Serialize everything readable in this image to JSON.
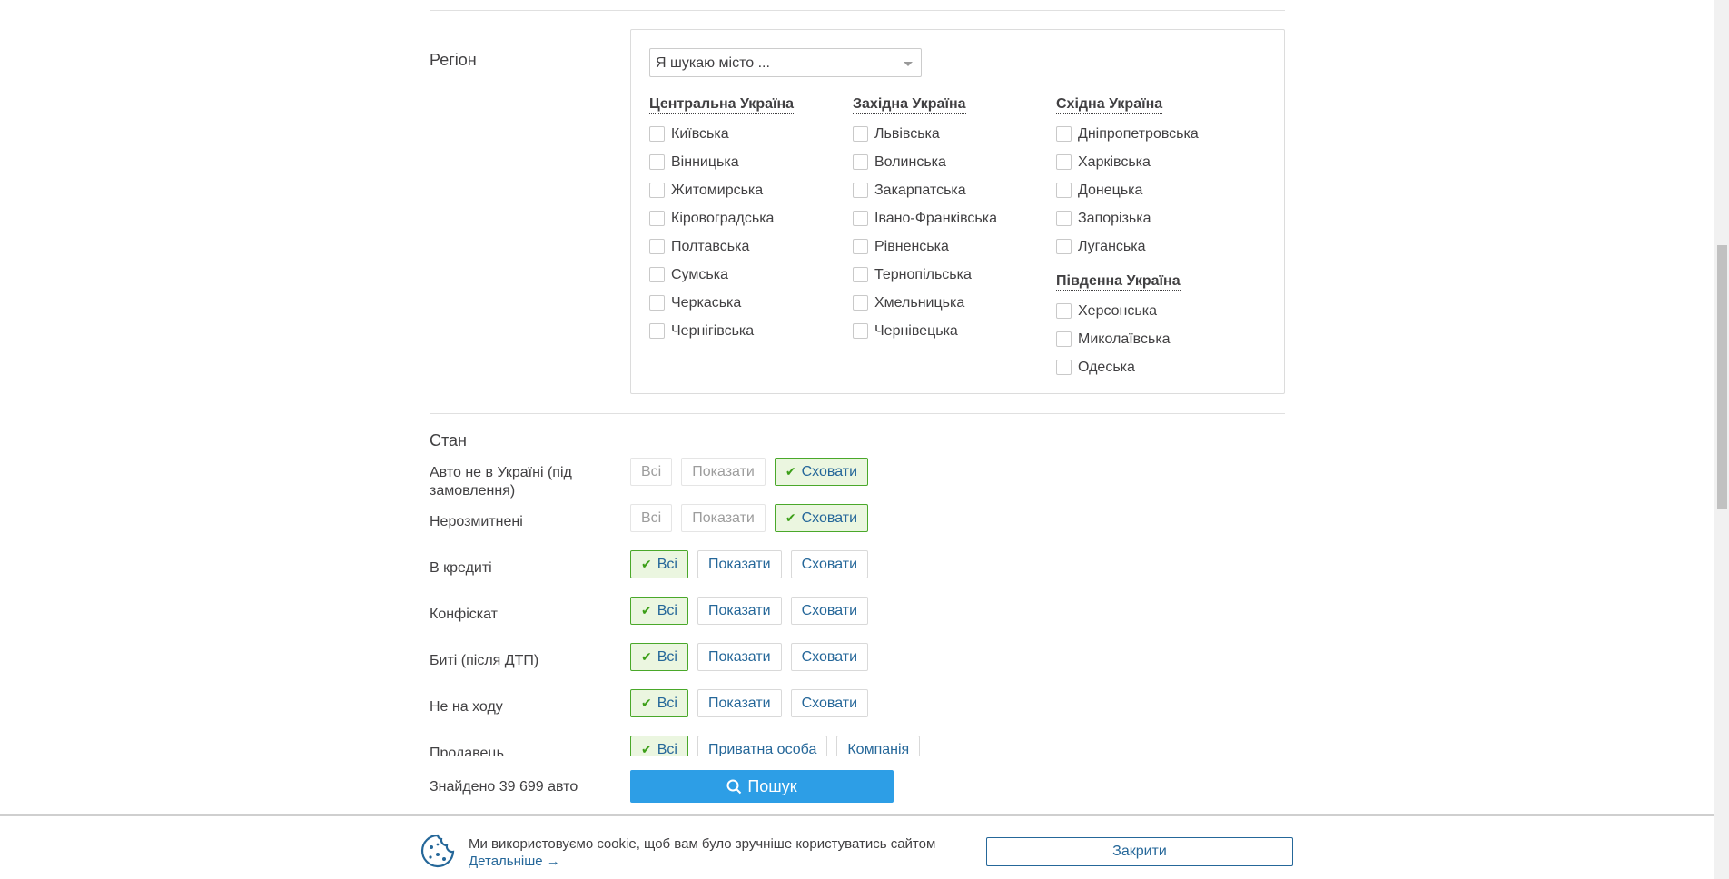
{
  "region": {
    "label": "Регіон",
    "city_placeholder": "Я шукаю місто ...",
    "groups": [
      {
        "title": "Центральна Україна",
        "items": [
          "Київська",
          "Вінницька",
          "Житомирська",
          "Кіровоградська",
          "Полтавська",
          "Сумська",
          "Черкаська",
          "Чернігівська"
        ]
      },
      {
        "title": "Західна Україна",
        "items": [
          "Львівська",
          "Волинська",
          "Закарпатська",
          "Івано-Франківська",
          "Рівненська",
          "Тернопільська",
          "Хмельницька",
          "Чернівецька"
        ]
      },
      {
        "title": "Східна Україна",
        "items": [
          "Дніпропетровська",
          "Харківська",
          "Донецька",
          "Запорізька",
          "Луганська"
        ]
      },
      {
        "title": "Південна Україна",
        "items": [
          "Херсонська",
          "Миколаївська",
          "Одеська"
        ]
      }
    ]
  },
  "state": {
    "title": "Стан",
    "rows": [
      {
        "label": "Авто не в Україні (під замовлення)",
        "buttons": [
          "Всі",
          "Показати",
          "Сховати"
        ],
        "selected": 2,
        "dim": true
      },
      {
        "label": "Нерозмитнені",
        "buttons": [
          "Всі",
          "Показати",
          "Сховати"
        ],
        "selected": 2,
        "dim": true
      },
      {
        "label": "В кредиті",
        "buttons": [
          "Всі",
          "Показати",
          "Сховати"
        ],
        "selected": 0,
        "dim": false
      },
      {
        "label": "Конфіскат",
        "buttons": [
          "Всі",
          "Показати",
          "Сховати"
        ],
        "selected": 0,
        "dim": false
      },
      {
        "label": "Биті (після ДТП)",
        "buttons": [
          "Всі",
          "Показати",
          "Сховати"
        ],
        "selected": 0,
        "dim": false
      },
      {
        "label": "Не на ходу",
        "buttons": [
          "Всі",
          "Показати",
          "Сховати"
        ],
        "selected": 0,
        "dim": false
      },
      {
        "label": "Продавець",
        "buttons": [
          "Всі",
          "Приватна особа",
          "Компанія"
        ],
        "selected": 0,
        "dim": false
      }
    ]
  },
  "footer": {
    "found_text": "Знайдено 39 699 авто",
    "search_label": "Пошук"
  },
  "cookie": {
    "text": "Ми використовуємо cookie, щоб вам було зручніше користуватись сайтом",
    "link": "Детальніше →",
    "close_label": "Закрити"
  },
  "colors": {
    "accent": "#2d9ee6",
    "link": "#256799",
    "selected_border": "#4aa82a",
    "selected_bg": "#ebf6e0"
  }
}
